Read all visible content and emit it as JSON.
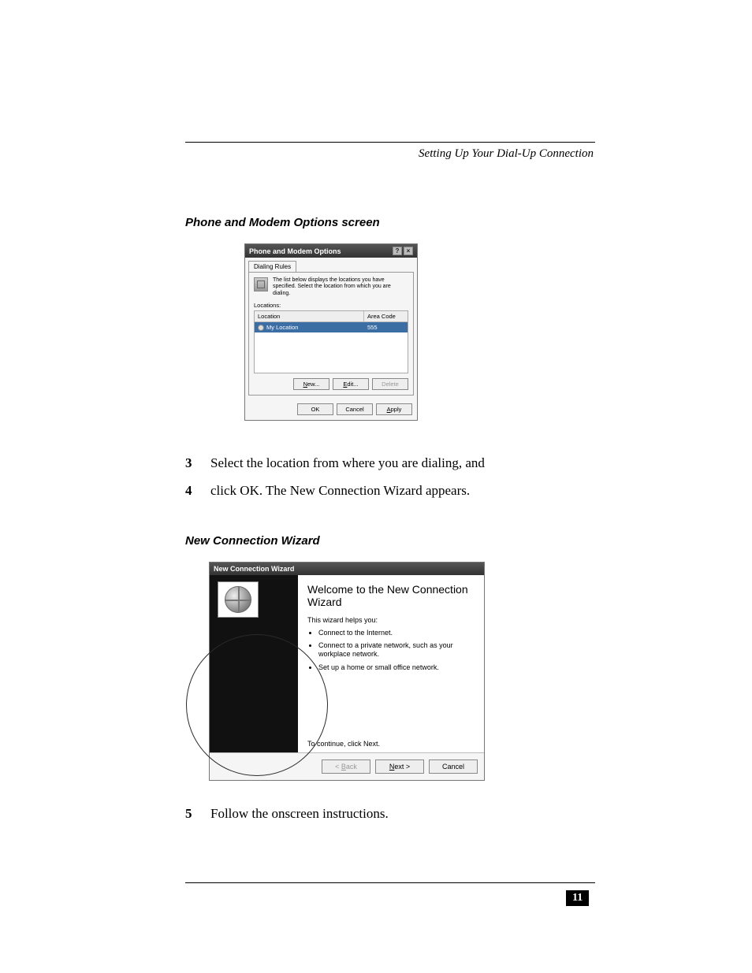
{
  "running_head": "Setting Up Your Dial-Up Connection",
  "section1_title": "Phone and Modem Options screen",
  "dlg1": {
    "title": "Phone and Modem Options",
    "help": "?",
    "close": "×",
    "tab": "Dialing Rules",
    "info": "The list below displays the locations you have specified. Select the location from which you are dialing.",
    "locations_label": "Locations:",
    "col_location": "Location",
    "col_area": "Area Code",
    "row_location": "My Location",
    "row_area": "555",
    "btn_new": "New...",
    "btn_edit": "Edit...",
    "btn_delete": "Delete",
    "btn_ok": "OK",
    "btn_cancel": "Cancel",
    "btn_apply": "Apply"
  },
  "steps": {
    "s3": {
      "n": "3",
      "t": "Select the location from where you are dialing, and"
    },
    "s4": {
      "n": "4",
      "t": "click OK. The New Connection Wizard appears."
    },
    "s5": {
      "n": "5",
      "t": "Follow the onscreen instructions."
    }
  },
  "section2_title": "New Connection Wizard",
  "dlg2": {
    "title": "New Connection Wizard",
    "heading": "Welcome to the New Connection Wizard",
    "intro": "This wizard helps you:",
    "b1": "Connect to the Internet.",
    "b2": "Connect to a private network, such as your workplace network.",
    "b3": "Set up a home or small office network.",
    "cont": "To continue, click Next.",
    "btn_back": "< Back",
    "btn_next": "Next >",
    "btn_cancel": "Cancel"
  },
  "page_number": "11"
}
